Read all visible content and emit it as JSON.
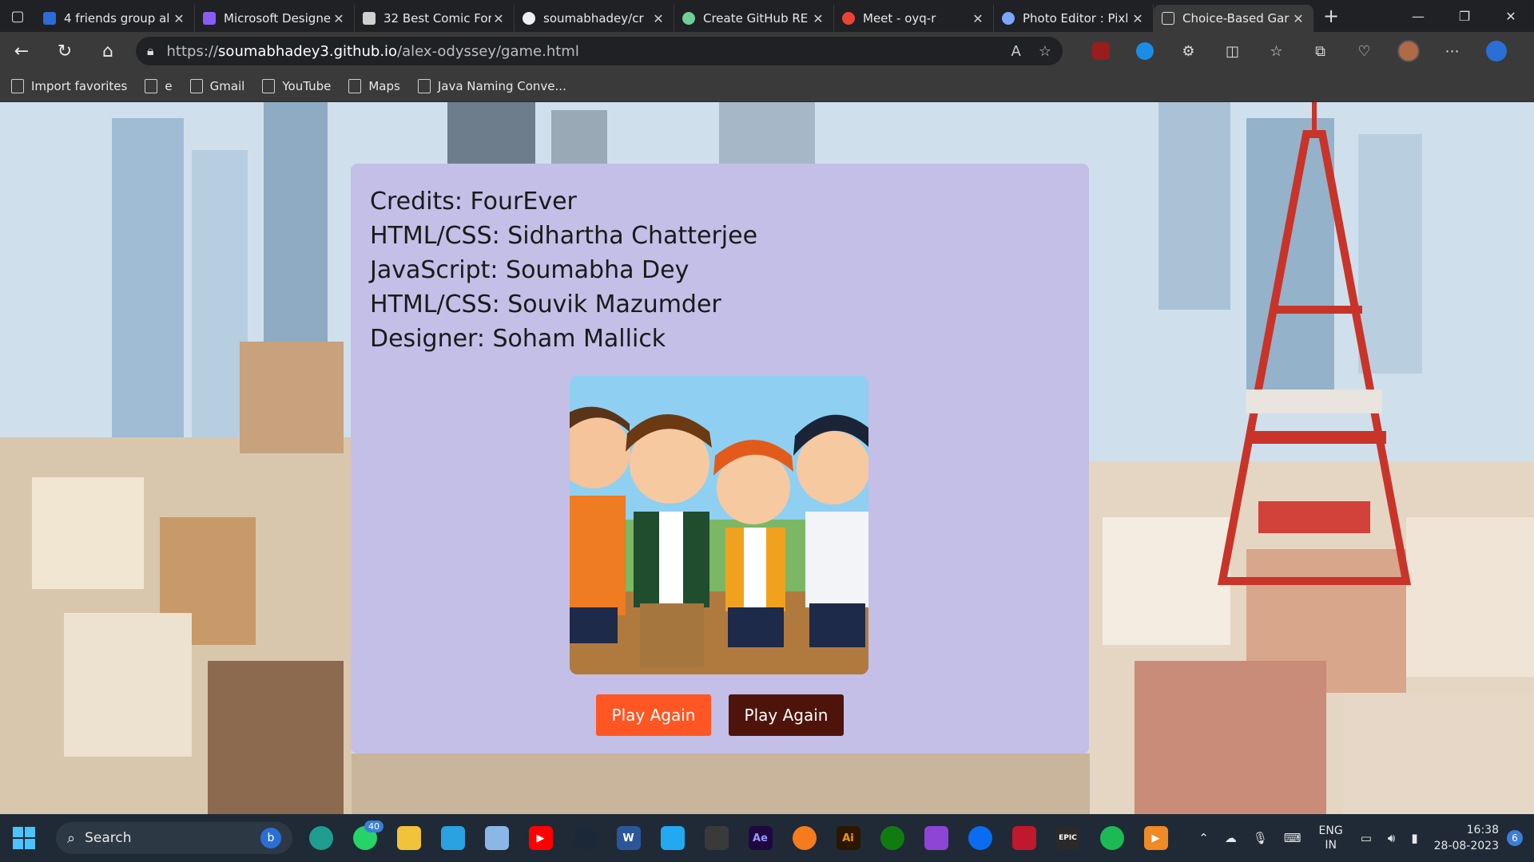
{
  "browser": {
    "tabs": [
      {
        "label": "4 friends group al",
        "color": "#2b6cd6"
      },
      {
        "label": "Microsoft Designe",
        "color": "#8a5cf6"
      },
      {
        "label": "32 Best Comic For",
        "color": "#d0d0d0"
      },
      {
        "label": "soumabhadey/cr",
        "color": "#f0f0f0"
      },
      {
        "label": "Create GitHub RE",
        "color": "#6fcf97"
      },
      {
        "label": "Meet - oyq-r",
        "color": "#ea4335"
      },
      {
        "label": "Photo Editor : Pixl",
        "color": "#7aa7ff"
      },
      {
        "label": "Choice-Based Gar",
        "color": "#ffffff"
      }
    ],
    "url_prefix": "https://",
    "url_domain": "soumabhadey3.github.io",
    "url_path": "/alex-odyssey/game.html",
    "favorites": [
      {
        "label": "Import favorites"
      },
      {
        "label": "e"
      },
      {
        "label": "Gmail"
      },
      {
        "label": "YouTube"
      },
      {
        "label": "Maps"
      },
      {
        "label": "Java Naming Conve..."
      }
    ]
  },
  "page": {
    "credits": [
      "Credits: FourEver",
      "HTML/CSS: Sidhartha Chatterjee",
      "JavaScript: Soumabha Dey",
      "HTML/CSS: Souvik Mazumder",
      "Designer: Soham Mallick"
    ],
    "buttons": {
      "play_again_1": "Play Again",
      "play_again_2": "Play Again"
    }
  },
  "taskbar": {
    "search_placeholder": "Search",
    "whatsapp_badge": "40",
    "language_line1": "ENG",
    "language_line2": "IN",
    "time": "16:38",
    "date": "28-08-2023",
    "notification_count": "6"
  }
}
